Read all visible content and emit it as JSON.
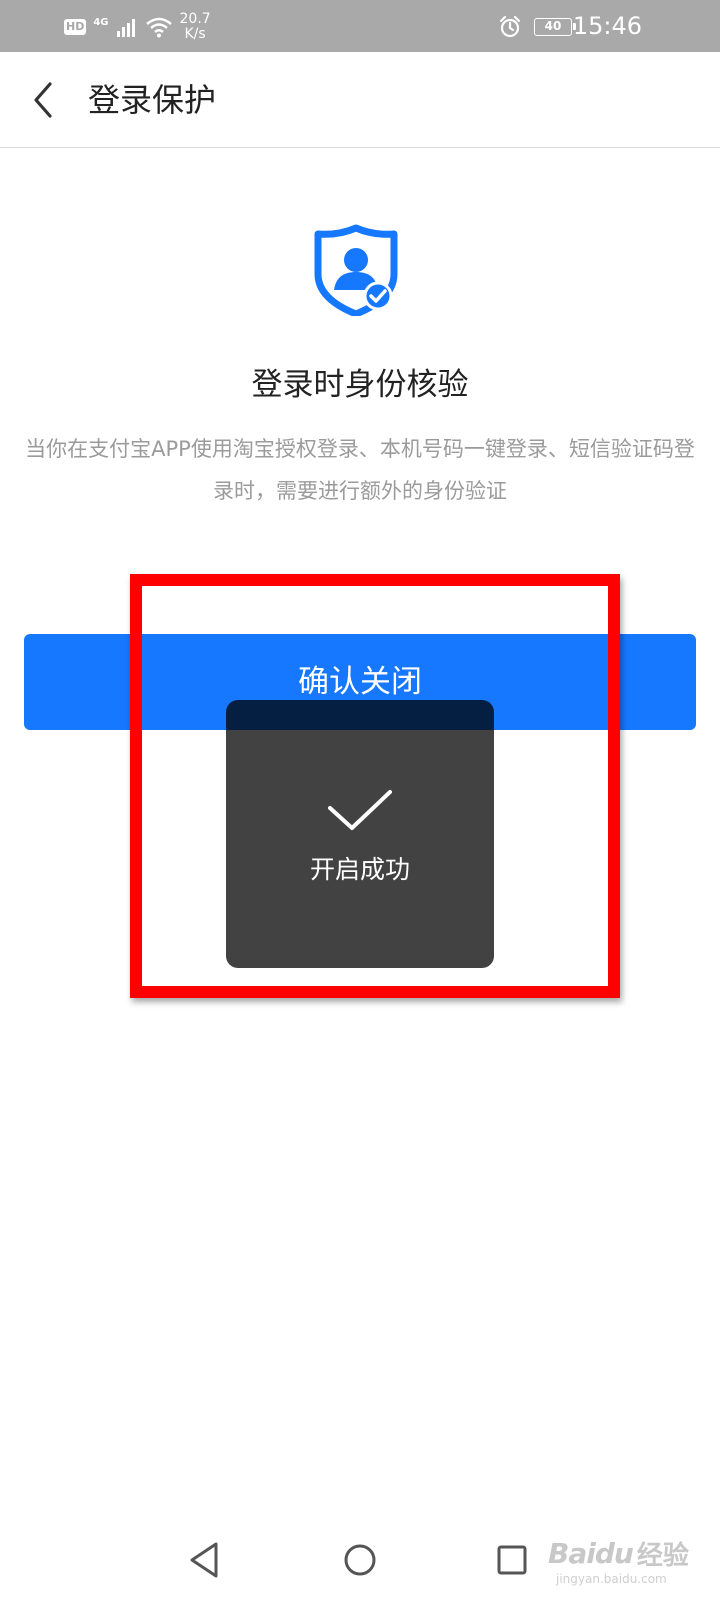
{
  "status_bar": {
    "hd": "HD",
    "network_type": "4G",
    "speed_value": "20.7",
    "speed_unit": "K/s",
    "battery_level": "40",
    "time": "15:46",
    "icons": [
      "hd-icon",
      "signal-icon",
      "wifi-icon",
      "alarm-icon",
      "battery-icon"
    ]
  },
  "header": {
    "title": "登录保护",
    "back_icon": "chevron-left-icon"
  },
  "content": {
    "icon": "shield-user-check-icon",
    "title": "登录时身份核验",
    "description": "当你在支付宝APP使用淘宝授权登录、本机号码一键登录、短信验证码登录时，需要进行额外的身份验证",
    "confirm_button": "确认关闭"
  },
  "toast": {
    "icon": "checkmark-icon",
    "message": "开启成功"
  },
  "annotation": {
    "highlight_color": "#ff0000"
  },
  "nav_bar": {
    "back": "triangle-back-icon",
    "home": "circle-home-icon",
    "recent": "square-recent-icon"
  },
  "watermark": {
    "logo": "Baidu",
    "text": "经验",
    "url": "jingyan.baidu.com"
  },
  "colors": {
    "accent": "#1677ff",
    "status_bar": "#a9a9a9",
    "toast_bg": "#404040",
    "description": "#9b9b9b"
  }
}
